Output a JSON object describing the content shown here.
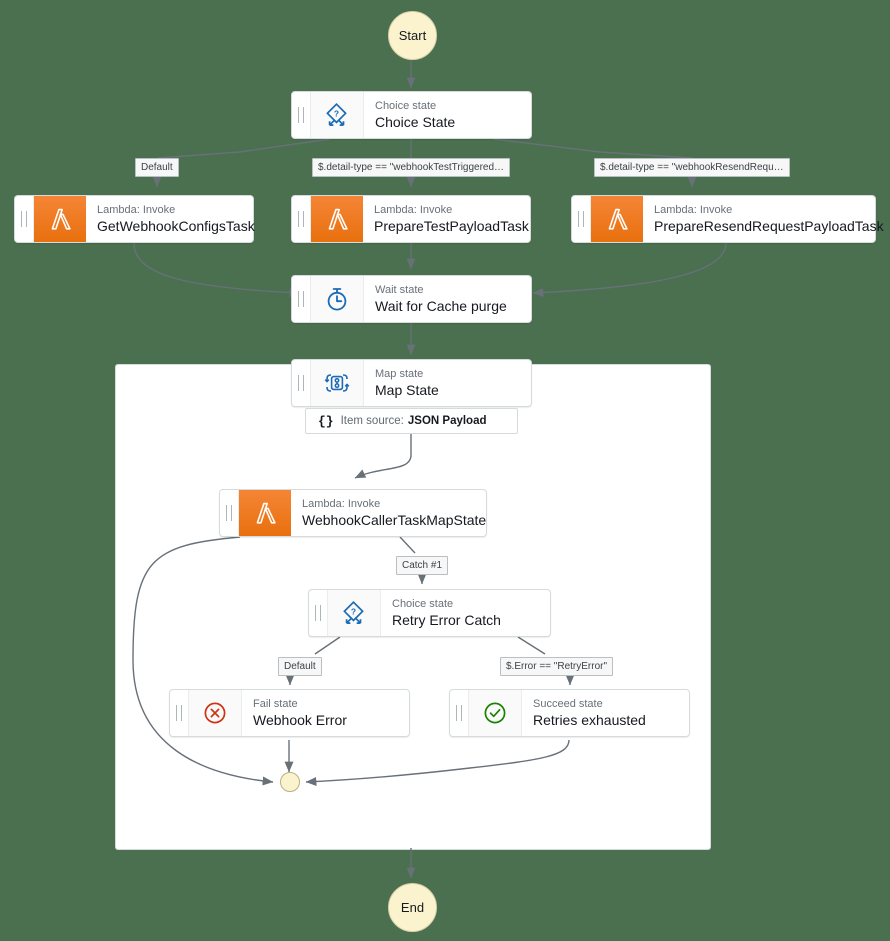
{
  "theme": {
    "canvas_background": "#4a7050",
    "card_background": "#ffffff",
    "card_border": "#d5dbdb",
    "terminal_fill": "#fbf3cd",
    "lambda_orange": "#e8700e",
    "icon_blue": "#1b6bb5",
    "fail_red": "#d13212",
    "succeed_green": "#1d8102",
    "edge_stroke": "#687078",
    "label_text": "#3d4347",
    "kind_text": "#687078",
    "title_text": "#16191f"
  },
  "terminals": {
    "start": {
      "label": "Start"
    },
    "end": {
      "label": "End"
    }
  },
  "states": {
    "choice_state": {
      "kind": "Choice state",
      "title": "Choice State",
      "icon": "choice-state-icon"
    },
    "get_webhook_configs": {
      "kind": "Lambda: Invoke",
      "title": "GetWebhookConfigsTask",
      "icon": "lambda-icon"
    },
    "prepare_test_payload": {
      "kind": "Lambda: Invoke",
      "title": "PrepareTestPayloadTask",
      "icon": "lambda-icon"
    },
    "prepare_resend_request_payload": {
      "kind": "Lambda: Invoke",
      "title": "PrepareResendRequestPayloadTask",
      "icon": "lambda-icon"
    },
    "wait_for_cache_purge": {
      "kind": "Wait state",
      "title": "Wait for Cache purge",
      "icon": "stopwatch-icon"
    },
    "map_state": {
      "kind": "Map state",
      "title": "Map State",
      "icon": "map-state-icon",
      "item_source_label": "Item source:",
      "item_source_value": "JSON Payload"
    },
    "webhook_caller_task": {
      "kind": "Lambda: Invoke",
      "title": "WebhookCallerTaskMapState",
      "icon": "lambda-icon"
    },
    "retry_error_catch": {
      "kind": "Choice state",
      "title": "Retry Error Catch",
      "icon": "choice-state-icon"
    },
    "webhook_error": {
      "kind": "Fail state",
      "title": "Webhook Error",
      "icon": "fail-state-icon"
    },
    "retries_exhausted": {
      "kind": "Succeed state",
      "title": "Retries exhausted",
      "icon": "succeed-state-icon"
    }
  },
  "edge_labels": {
    "choice_default": "Default",
    "choice_test_triggered": "$.detail-type == \"webhookTestTriggered…",
    "choice_resend_request": "$.detail-type == \"webhookResendReque…",
    "catch_1": "Catch #1",
    "retry_default": "Default",
    "retry_error": "$.Error == \"RetryError\""
  }
}
